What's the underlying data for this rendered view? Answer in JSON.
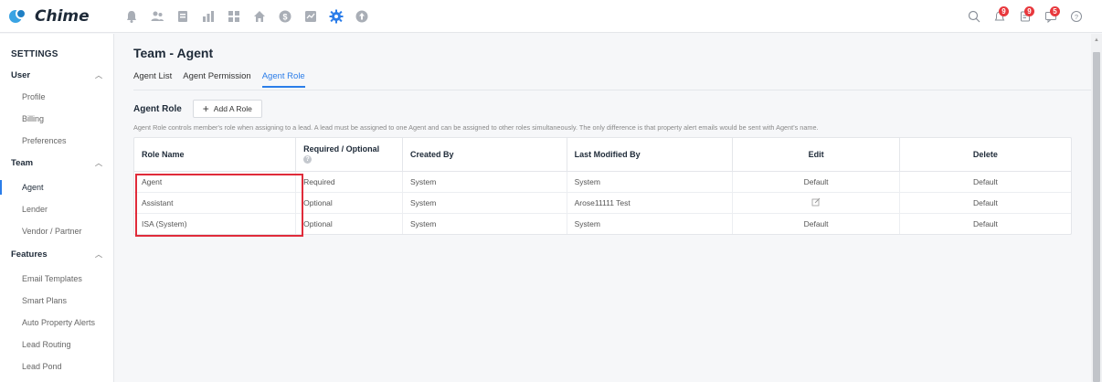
{
  "app": {
    "name": "Chime",
    "accent": "#2b7de9",
    "highlight_color": "#e02b3a"
  },
  "topnav": {
    "icons": [
      "bell-icon",
      "people-icon",
      "clipboard-icon",
      "bar-chart-icon",
      "grid-icon",
      "home-icon",
      "dollar-icon",
      "analytics-icon",
      "gear-icon",
      "upload-icon"
    ],
    "right": {
      "notification_badge": "9",
      "task_badge": "9",
      "message_badge": "5"
    }
  },
  "sidebar": {
    "heading": "SETTINGS",
    "groups": [
      {
        "label": "User",
        "items": [
          "Profile",
          "Billing",
          "Preferences"
        ]
      },
      {
        "label": "Team",
        "items": [
          "Agent",
          "Lender",
          "Vendor / Partner"
        ]
      },
      {
        "label": "Features",
        "items": [
          "Email Templates",
          "Smart Plans",
          "Auto Property Alerts",
          "Lead Routing",
          "Lead Pond"
        ]
      }
    ],
    "active_item": "Agent"
  },
  "page": {
    "title": "Team - Agent",
    "tabs": [
      "Agent List",
      "Agent Permission",
      "Agent Role"
    ],
    "active_tab": "Agent Role"
  },
  "role_section": {
    "title": "Agent Role",
    "add_button": "Add A Role",
    "description": "Agent Role controls member's role when assigning to a lead. A lead must be assigned to one Agent and can be assigned to other roles simultaneously. The only difference is that property alert emails would be sent with Agent's name."
  },
  "table": {
    "columns": [
      "Role Name",
      "Required / Optional",
      "Created By",
      "Last Modified By",
      "Edit",
      "Delete"
    ],
    "rows": [
      {
        "role": "Agent",
        "req": "Required",
        "created": "System",
        "modified": "System",
        "edit": "Default",
        "delete": "Default"
      },
      {
        "role": "Assistant",
        "req": "Optional",
        "created": "System",
        "modified": "Arose11111 Test",
        "edit": "",
        "delete": "Default"
      },
      {
        "role": "ISA (System)",
        "req": "Optional",
        "created": "System",
        "modified": "System",
        "edit": "Default",
        "delete": "Default"
      }
    ]
  }
}
